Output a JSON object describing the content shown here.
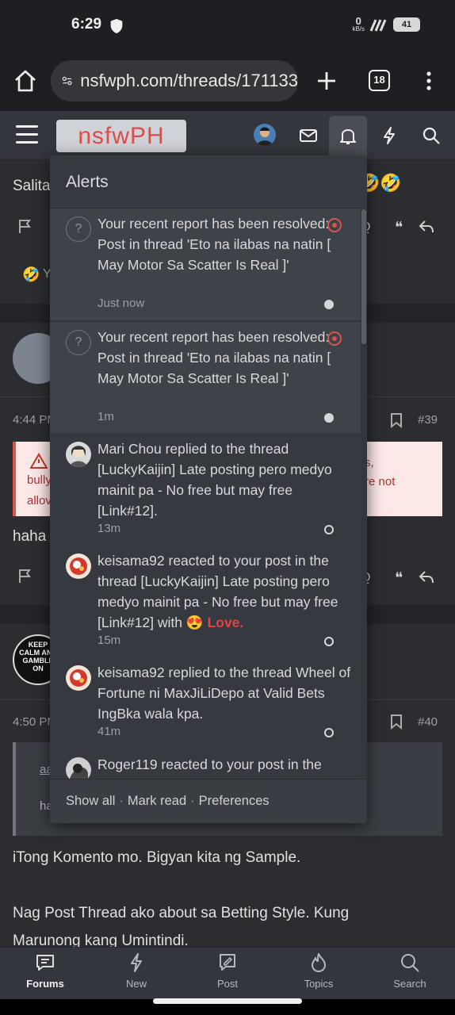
{
  "status_bar": {
    "time": "6:29",
    "net_speed_value": "0",
    "net_speed_unit": "kB/s",
    "battery": "41"
  },
  "browser": {
    "url": "nsfwph.com/threads/171133",
    "tab_count": "18"
  },
  "header": {
    "logo_text": "nsfwPH"
  },
  "background_page": {
    "post1_partial_text": "Salita",
    "post1_reaction_partial": "Y",
    "post2_time": "4:44 PM",
    "post2_number": "#39",
    "post2_warning_left_1": "bully",
    "post2_warning_left_2": "allov",
    "post2_warning_right_1": "s,",
    "post2_warning_right_2": "re not",
    "post2_body": "haha",
    "post3_avatar_text": "KEEP CALM AND GAMBLE ON",
    "post3_time": "4:50 PM",
    "post3_number": "#40",
    "post3_quote_author_partial": "aa",
    "post3_quote_text_partial": "ha",
    "post3_body_line1": "iTong Komento mo. Bigyan kita ng Sample.",
    "post3_body_line2": "Nag Post Thread ako about sa Betting Style. Kung",
    "post3_body_line3": "Marunong kang Umintindi."
  },
  "alerts": {
    "title": "Alerts",
    "items": [
      {
        "text": "Your recent report has been resolved: Post in thread 'Eto na ilabas na natin [ May Motor Sa Scatter Is Real ]'",
        "time": "Just now"
      },
      {
        "text": "Your recent report has been resolved: Post in thread 'Eto na ilabas na natin [ May Motor Sa Scatter Is Real ]'",
        "time": "1m"
      },
      {
        "text": "Mari Chou replied to the thread [LuckyKaijin] Late posting pero medyo mainit pa - No free but may free [Link#12].",
        "time": "13m"
      },
      {
        "text": "keisama92 reacted to your post in the thread [LuckyKaijin] Late posting pero medyo mainit pa - No free but may free [Link#12] with",
        "reaction": "Love.",
        "time": "15m"
      },
      {
        "text": "keisama92 replied to the thread Wheel of Fortune ni MaxJiLiDepo at Valid Bets IngBka wala kpa.",
        "time": "41m"
      },
      {
        "text": "Roger119 reacted to your post in the"
      }
    ],
    "footer": {
      "show_all": "Show all",
      "mark_read": "Mark read",
      "preferences": "Preferences",
      "separator": "·"
    }
  },
  "bottom_nav": {
    "items": [
      {
        "label": "Forums"
      },
      {
        "label": "New"
      },
      {
        "label": "Post"
      },
      {
        "label": "Topics"
      },
      {
        "label": "Search"
      }
    ]
  }
}
